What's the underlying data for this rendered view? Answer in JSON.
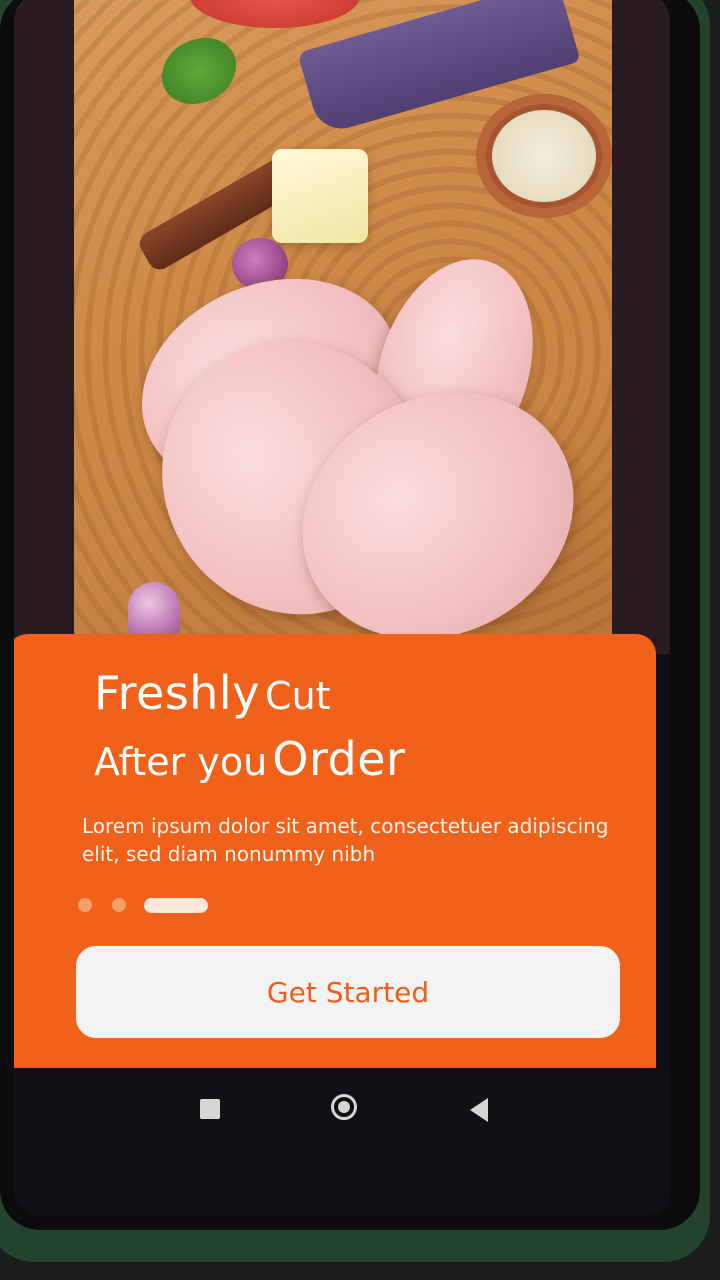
{
  "onboarding": {
    "headline": {
      "line1_bold": "Freshly",
      "line1_rest": "Cut",
      "line2_rest": "After you",
      "line2_bold": "Order"
    },
    "description": "Lorem ipsum dolor sit amet, consectetuer adipiscing elit, sed diam nonummy nibh",
    "page_indicator": {
      "total": 3,
      "active_index": 3
    },
    "cta_label": "Get Started"
  },
  "system_nav": {
    "icons": [
      "recents-square-icon",
      "home-circle-icon",
      "back-triangle-icon"
    ]
  },
  "colors": {
    "accent": "#f0611b",
    "cta_background": "#f3f3f3",
    "cta_text": "#ee5d1b"
  }
}
